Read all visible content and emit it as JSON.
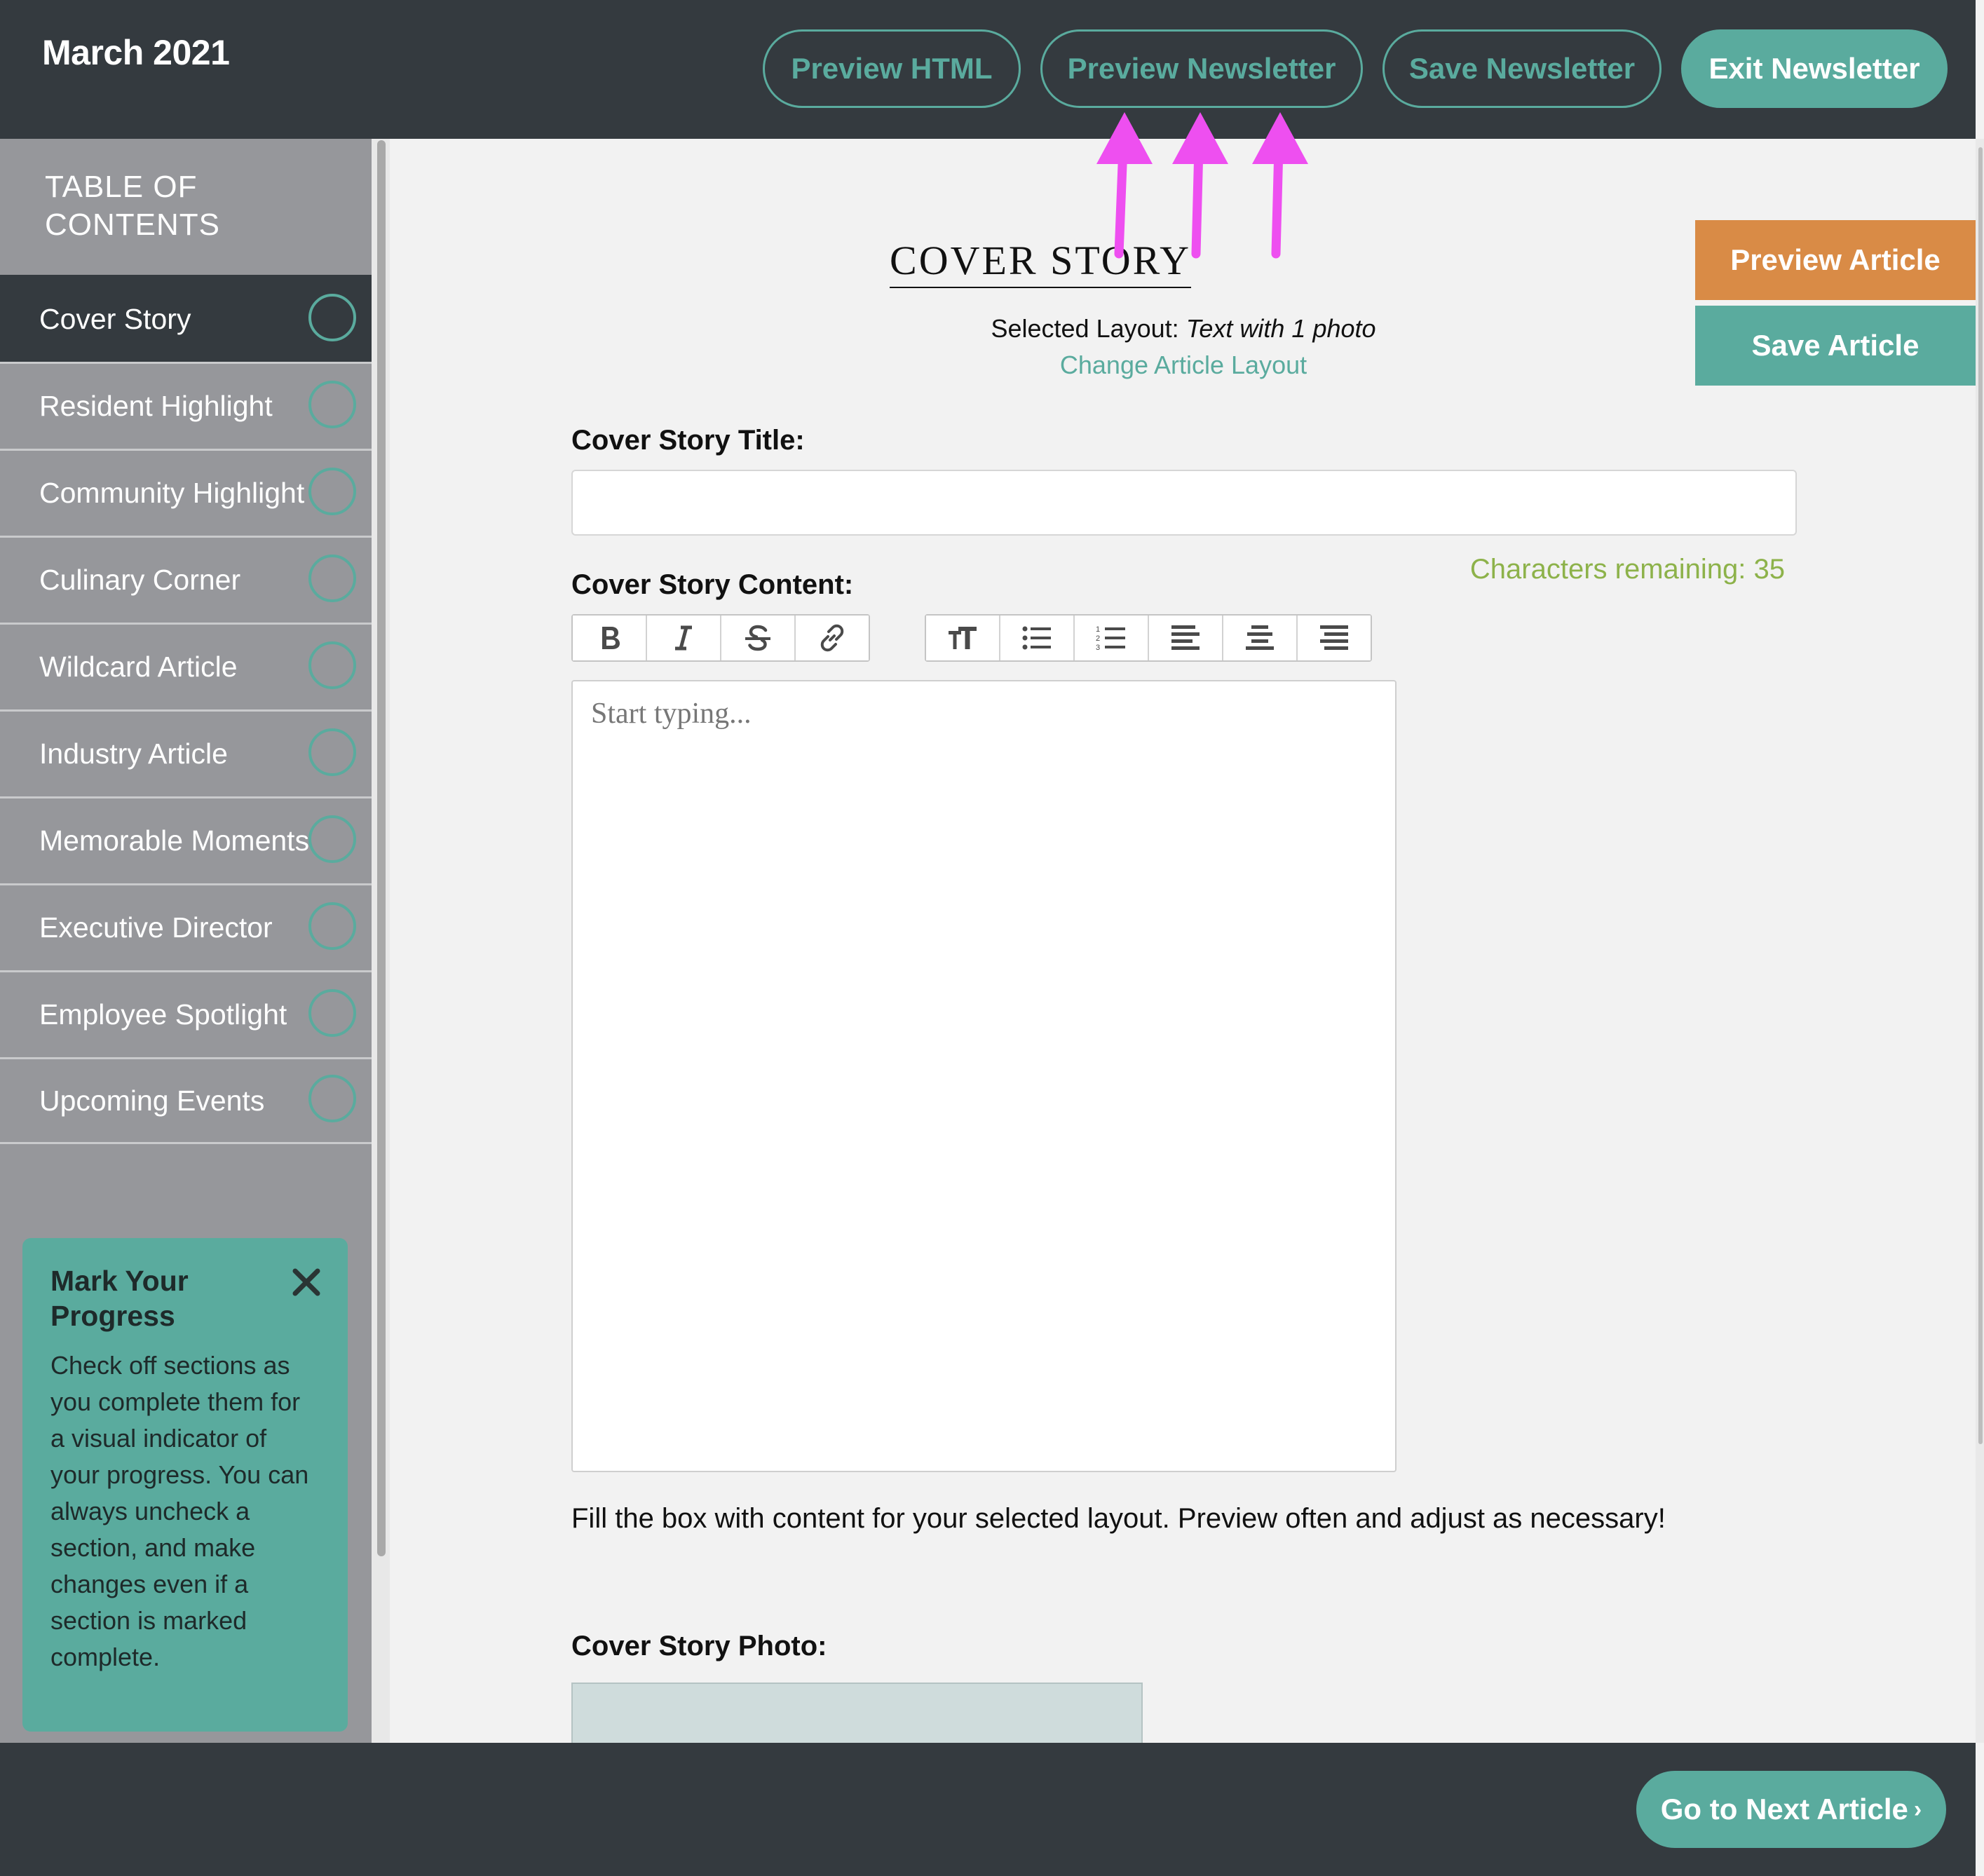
{
  "header": {
    "title": "March 2021",
    "buttons": {
      "preview_html": "Preview HTML",
      "preview_newsletter": "Preview Newsletter",
      "save_newsletter": "Save Newsletter",
      "exit_newsletter": "Exit Newsletter"
    }
  },
  "sidebar": {
    "title_line1": "TABLE OF",
    "title_line2": "CONTENTS",
    "items": [
      {
        "label": "Cover Story",
        "active": true
      },
      {
        "label": "Resident Highlight"
      },
      {
        "label": "Community Highlight"
      },
      {
        "label": "Culinary Corner"
      },
      {
        "label": "Wildcard Article"
      },
      {
        "label": "Industry Article"
      },
      {
        "label": "Memorable Moments"
      },
      {
        "label": "Executive Director"
      },
      {
        "label": "Employee Spotlight"
      },
      {
        "label": "Upcoming Events"
      }
    ],
    "tip": {
      "title": "Mark Your Progress",
      "body": "Check off sections as you complete them for a visual indicator of your progress. You can always uncheck a section, and make changes even if a section is marked complete."
    }
  },
  "main": {
    "heading": "COVER STORY",
    "layout_prefix": "Selected Layout:",
    "layout_value": "Text with 1 photo",
    "change_layout": "Change Article Layout",
    "preview_article": "Preview Article",
    "save_article": "Save Article",
    "title_label": "Cover Story Title:",
    "title_value": "",
    "content_label": "Cover Story Content:",
    "chars_remaining": "Characters remaining: 35",
    "editor_placeholder": "Start typing...",
    "helper_text": "Fill the box with content for your selected layout. Preview often and adjust as necessary!",
    "photo_label": "Cover Story Photo:"
  },
  "toolbar": {
    "icons": [
      "bold-icon",
      "italic-icon",
      "strikethrough-icon",
      "link-icon",
      "text-size-icon",
      "bulleted-list-icon",
      "numbered-list-icon",
      "align-left-icon",
      "align-center-icon",
      "align-right-icon"
    ]
  },
  "footer": {
    "next_label": "Go to Next Article",
    "next_chevron": "›"
  },
  "colors": {
    "teal": "#5aab9e",
    "dark": "#343a3f",
    "orange": "#d98b46",
    "sidebar": "#96979b",
    "green_text": "#8db24a",
    "annotation": "#ee4ff0"
  }
}
